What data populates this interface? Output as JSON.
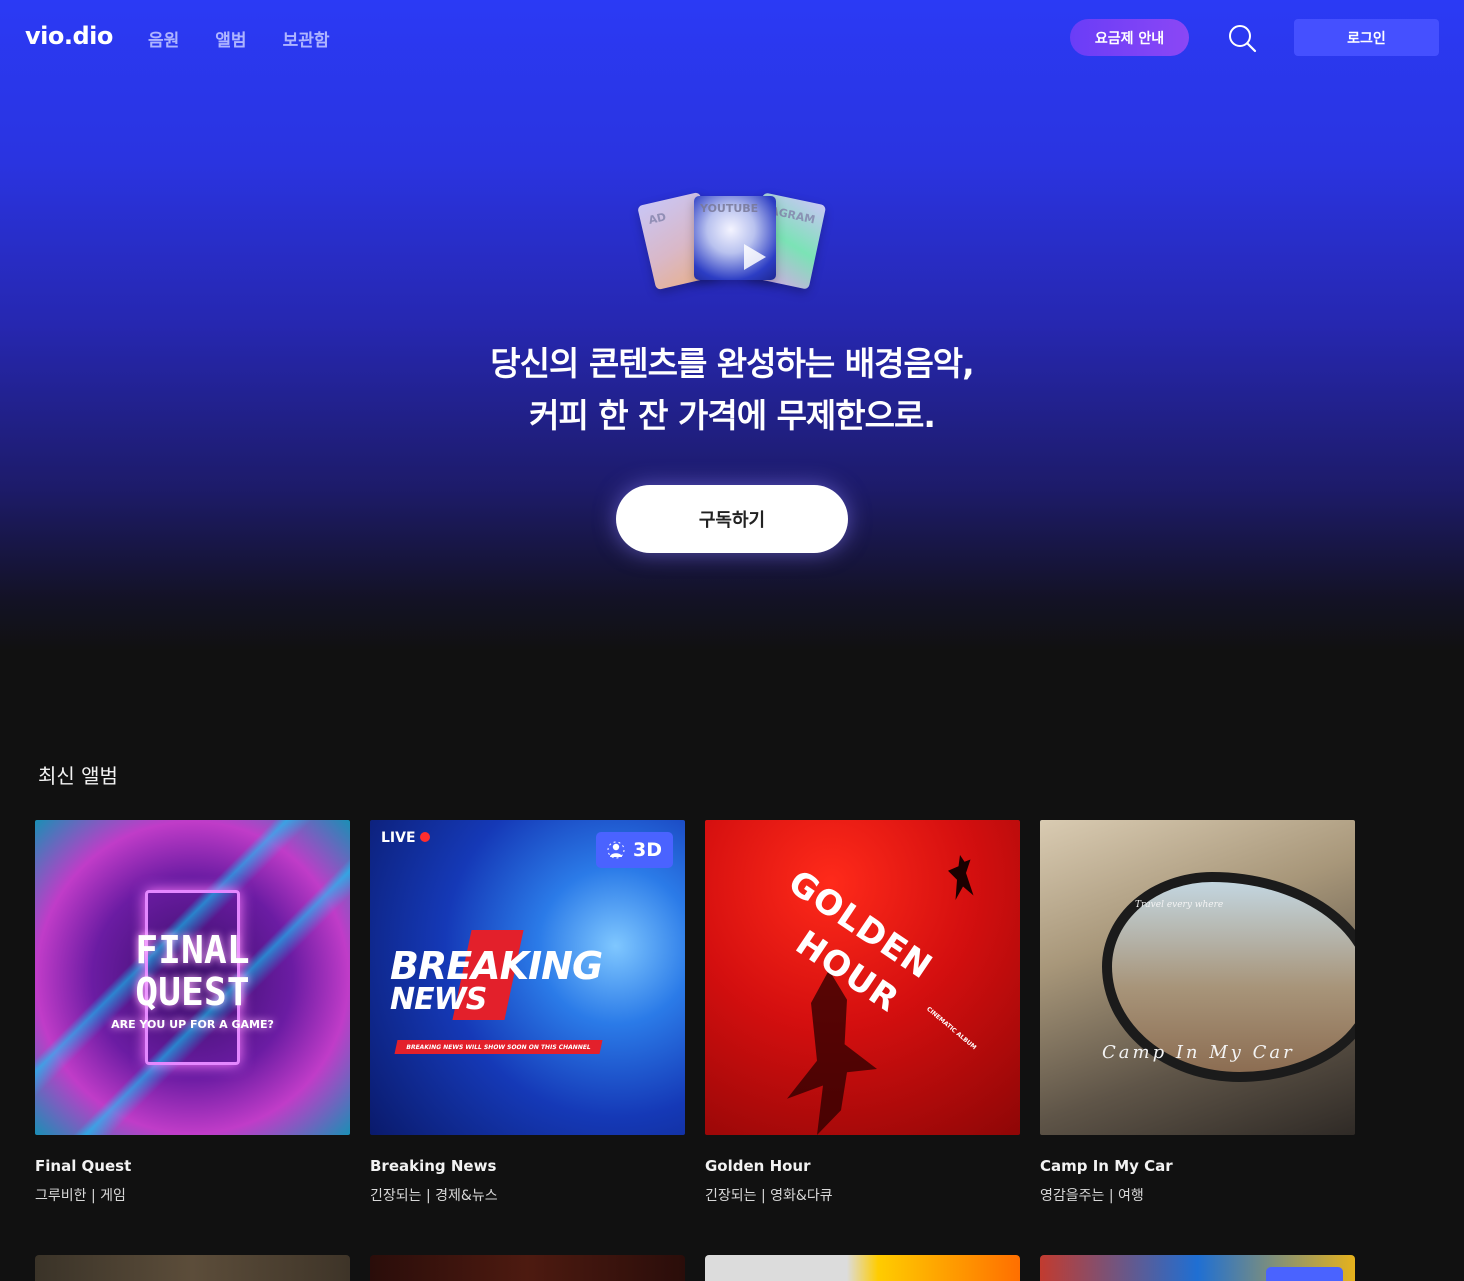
{
  "header": {
    "logo": "vio.dio",
    "nav": [
      "음원",
      "앨범",
      "보관함"
    ],
    "pricing_label": "요금제 안내",
    "login_label": "로그인"
  },
  "hero": {
    "card_labels": [
      "AD",
      "YOUTUBE",
      "AGRAM"
    ],
    "headline_line1": "당신의 콘텐츠를 완성하는 배경음악,",
    "headline_line2": "커피 한 잔 가격에 무제한으로.",
    "subscribe_label": "구독하기"
  },
  "section": {
    "title": "최신 앨범"
  },
  "albums": [
    {
      "title": "Final Quest",
      "meta": "그루비한 | 게임",
      "cover_text": [
        "FINAL",
        "QUEST",
        "ARE YOU UP FOR A GAME?"
      ]
    },
    {
      "title": "Breaking News",
      "meta": "긴장되는 | 경제&뉴스",
      "cover_text": [
        "LIVE",
        "BREAKING",
        "NEWS",
        "BREAKING NEWS WILL SHOW SOON ON THIS CHANNEL"
      ],
      "badge": "3D"
    },
    {
      "title": "Golden Hour",
      "meta": "긴장되는 | 영화&다큐",
      "cover_text": [
        "GOLDEN",
        "HOUR",
        "CINEMATIC ALBUM"
      ]
    },
    {
      "title": "Camp In My Car",
      "meta": "영감을주는 | 여행",
      "cover_text": [
        "Travel every where",
        "Camp In My Car"
      ]
    }
  ],
  "colors": {
    "accent": "#4550ff",
    "pricing": "#7a42f6",
    "badge": "#4a63ff",
    "background": "#111111"
  }
}
